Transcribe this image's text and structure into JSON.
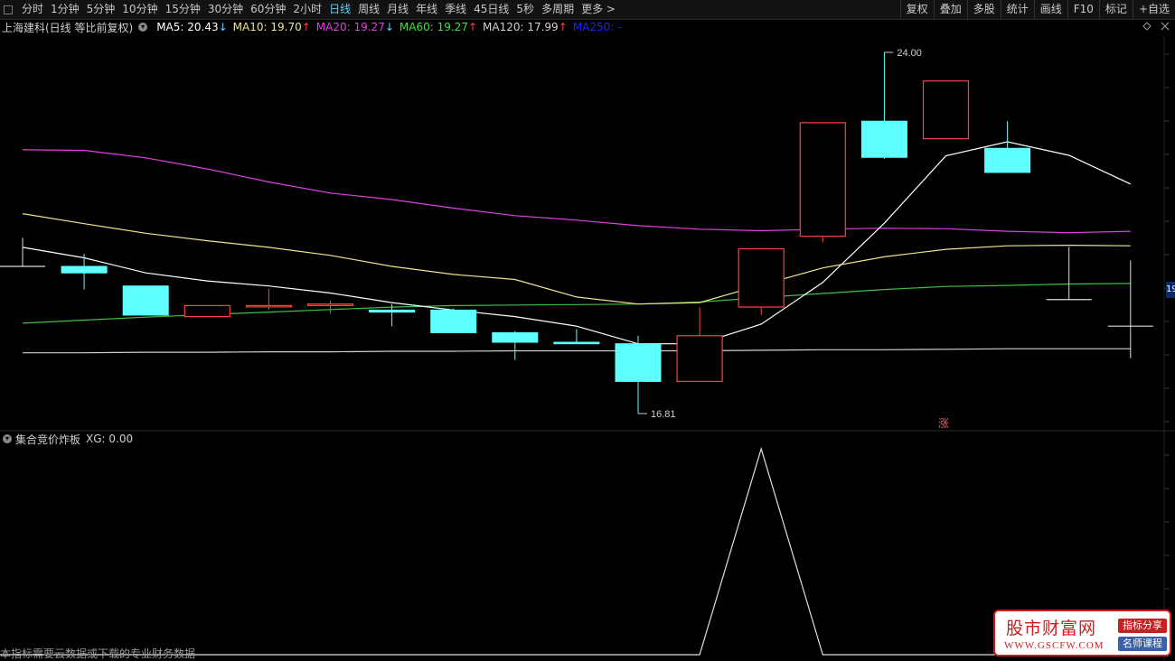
{
  "toolbar": {
    "periods": [
      "分时",
      "1分钟",
      "5分钟",
      "10分钟",
      "15分钟",
      "30分钟",
      "60分钟",
      "2小时",
      "日线",
      "周线",
      "月线",
      "年线",
      "季线",
      "45日线",
      "5秒",
      "多周期",
      "更多 >"
    ],
    "active_period": "日线",
    "right_buttons": [
      "复权",
      "叠加",
      "多股",
      "统计",
      "画线",
      "F10",
      "标记",
      "+自选"
    ]
  },
  "info": {
    "stock_title": "上海建科(日线 等比前复权)",
    "ma": [
      {
        "label": "MA5: 20.43",
        "arrow": "↓",
        "color": "#ffffff",
        "dir": "down"
      },
      {
        "label": "MA10: 19.70",
        "arrow": "↑",
        "color": "#f0e68c",
        "dir": "up"
      },
      {
        "label": "MA20: 19.27",
        "arrow": "↓",
        "color": "#e040e0",
        "dir": "down"
      },
      {
        "label": "MA60: 19.27",
        "arrow": "↑",
        "color": "#40e040",
        "dir": "up"
      },
      {
        "label": "MA120: 17.99",
        "arrow": "↑",
        "color": "#d0d0d0",
        "dir": "up"
      },
      {
        "label": "MA250: -",
        "arrow": "",
        "color": "#2020ff",
        "dir": ""
      }
    ]
  },
  "chart": {
    "high_label": "24.00",
    "low_label": "16.81",
    "zhang_label": "涨",
    "price_mark": "19"
  },
  "indicator": {
    "title": "集合竞价炸板",
    "value_label": "XG: 0.00"
  },
  "footnote": "本指标需要云数据或下载的专业财务数据",
  "watermark": {
    "name": "股市财富网",
    "url": "WWW.GSCFW.COM",
    "tag1": "指标分享",
    "tag2": "名师课程"
  },
  "colors": {
    "up": "#ff4040",
    "down": "#5fffff",
    "ma5": "#ffffff",
    "ma10": "#f0e68c",
    "ma20": "#e040e0",
    "ma60": "#40c040",
    "ma120": "#d0d0d0"
  },
  "chart_data": {
    "type": "candlestick",
    "candles": [
      {
        "o": 19.74,
        "h": 20.31,
        "c": 19.74,
        "l": 19.74,
        "dir": "flat"
      },
      {
        "o": 19.74,
        "h": 19.99,
        "c": 19.61,
        "l": 19.28,
        "dir": "down"
      },
      {
        "o": 19.35,
        "h": 19.35,
        "c": 18.77,
        "l": 18.77,
        "dir": "down"
      },
      {
        "o": 18.74,
        "h": 18.96,
        "c": 18.96,
        "l": 18.74,
        "dir": "up"
      },
      {
        "o": 18.96,
        "h": 19.3,
        "c": 18.96,
        "l": 18.87,
        "dir": "up"
      },
      {
        "o": 18.99,
        "h": 19.06,
        "c": 18.96,
        "l": 18.8,
        "dir": "up"
      },
      {
        "o": 18.87,
        "h": 18.99,
        "c": 18.83,
        "l": 18.55,
        "dir": "down"
      },
      {
        "o": 18.87,
        "h": 18.9,
        "c": 18.42,
        "l": 18.42,
        "dir": "down"
      },
      {
        "o": 18.42,
        "h": 18.45,
        "c": 18.23,
        "l": 17.88,
        "dir": "down"
      },
      {
        "o": 18.23,
        "h": 18.49,
        "c": 18.2,
        "l": 18.2,
        "dir": "down"
      },
      {
        "o": 18.2,
        "h": 18.36,
        "c": 17.45,
        "l": 16.81,
        "dir": "down"
      },
      {
        "o": 17.45,
        "h": 18.93,
        "c": 18.36,
        "l": 17.45,
        "dir": "up"
      },
      {
        "o": 18.93,
        "h": 20.09,
        "c": 20.09,
        "l": 18.77,
        "dir": "up"
      },
      {
        "o": 20.34,
        "h": 22.6,
        "c": 22.6,
        "l": 20.22,
        "dir": "up"
      },
      {
        "o": 22.63,
        "h": 24.0,
        "c": 21.91,
        "l": 21.88,
        "dir": "down"
      },
      {
        "o": 22.28,
        "h": 23.43,
        "c": 23.43,
        "l": 22.28,
        "dir": "up"
      },
      {
        "o": 22.09,
        "h": 22.63,
        "c": 21.61,
        "l": 21.61,
        "dir": "down"
      },
      {
        "o": 19.08,
        "h": 20.13,
        "c": 19.08,
        "l": 19.08,
        "dir": "flat"
      },
      {
        "o": 18.55,
        "h": 19.86,
        "c": 18.55,
        "l": 17.91,
        "dir": "flat"
      }
    ],
    "ma5": [
      20.12,
      19.91,
      19.61,
      19.45,
      19.35,
      19.21,
      19.02,
      18.87,
      18.74,
      18.55,
      18.2,
      18.2,
      18.59,
      19.42,
      20.6,
      21.94,
      22.22,
      21.95,
      21.38
    ],
    "ma10": [
      20.79,
      20.59,
      20.4,
      20.25,
      20.12,
      19.96,
      19.74,
      19.58,
      19.48,
      19.13,
      18.99,
      19.02,
      19.37,
      19.71,
      19.93,
      20.08,
      20.15,
      20.16,
      20.15
    ],
    "ma20": [
      22.06,
      22.05,
      21.9,
      21.68,
      21.42,
      21.2,
      21.07,
      20.9,
      20.75,
      20.66,
      20.55,
      20.48,
      20.45,
      20.48,
      20.5,
      20.49,
      20.44,
      20.41,
      20.44
    ],
    "ma60": [
      18.61,
      18.67,
      18.73,
      18.78,
      18.83,
      18.88,
      18.93,
      18.96,
      18.97,
      18.98,
      18.99,
      19.03,
      19.12,
      19.2,
      19.28,
      19.34,
      19.36,
      19.39,
      19.4
    ],
    "ma120": [
      18.02,
      18.02,
      18.03,
      18.03,
      18.04,
      18.04,
      18.05,
      18.05,
      18.06,
      18.06,
      18.06,
      18.06,
      18.07,
      18.08,
      18.08,
      18.09,
      18.1,
      18.1,
      18.1
    ],
    "indicator_xg": [
      0,
      0,
      0,
      0,
      0,
      0,
      0,
      0,
      0,
      0,
      0,
      0,
      1,
      0,
      0,
      0,
      0,
      0,
      0
    ]
  }
}
